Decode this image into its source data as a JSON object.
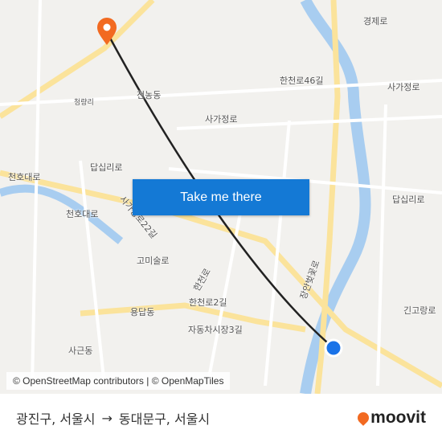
{
  "map": {
    "labels": [
      "경제로",
      "한천로46길",
      "사가정로",
      "전농동",
      "사가정로",
      "답십리로",
      "천호대로",
      "천호대로",
      "고미술로",
      "한천로2길",
      "용답동",
      "자동차시장3길",
      "사근동",
      "긴고랑로",
      "답십리로",
      "한천로",
      "장안벚꽃로",
      "청량리",
      "사가정로22길"
    ],
    "cta_label": "Take me there",
    "attribution": "© OpenStreetMap contributors | © OpenMapTiles"
  },
  "footer": {
    "origin": "광진구, 서울시",
    "arrow": "→",
    "destination": "동대문구, 서울시",
    "brand": "moovit"
  },
  "colors": {
    "accent": "#1479d5",
    "pin": "#f26a21",
    "river": "#a8cdf0",
    "major_road": "#fbe39b"
  }
}
